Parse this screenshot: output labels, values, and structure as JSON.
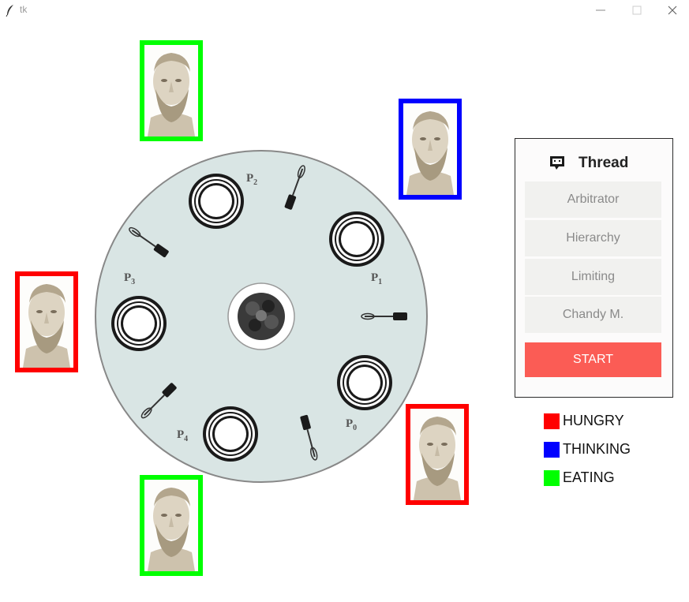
{
  "window": {
    "title": "tk"
  },
  "table": {
    "seat_labels": [
      {
        "id": "p0",
        "letter": "P",
        "sub": "0"
      },
      {
        "id": "p1",
        "letter": "P",
        "sub": "1"
      },
      {
        "id": "p2",
        "letter": "P",
        "sub": "2"
      },
      {
        "id": "p3",
        "letter": "P",
        "sub": "3"
      },
      {
        "id": "p4",
        "letter": "P",
        "sub": "4"
      }
    ]
  },
  "philosophers": [
    {
      "id": "top-left",
      "state": "EATING"
    },
    {
      "id": "top-right",
      "state": "THINKING"
    },
    {
      "id": "left",
      "state": "HUNGRY"
    },
    {
      "id": "bottom-right",
      "state": "HUNGRY"
    },
    {
      "id": "bottom-left",
      "state": "EATING"
    }
  ],
  "panel": {
    "title": "Thread",
    "options": [
      "Arbitrator",
      "Hierarchy",
      "Limiting",
      "Chandy M."
    ],
    "start_label": "START"
  },
  "legend": [
    {
      "label": "HUNGRY",
      "color": "#ff0000"
    },
    {
      "label": "THINKING",
      "color": "#0000ff"
    },
    {
      "label": "EATING",
      "color": "#00ff00"
    }
  ],
  "colors": {
    "hungry": "#ff0000",
    "thinking": "#0000ff",
    "eating": "#00ff00",
    "start_button": "#fb5c55",
    "table": "#d9e5e4"
  }
}
